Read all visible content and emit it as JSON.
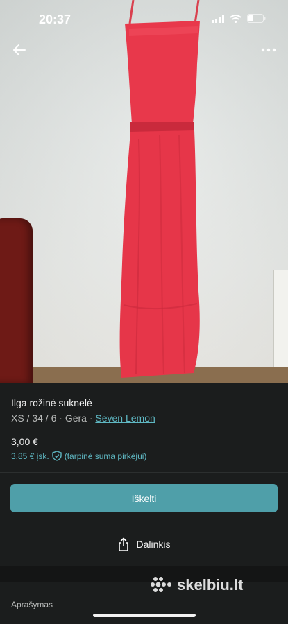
{
  "status_bar": {
    "time": "20:37"
  },
  "listing": {
    "title": "Ilga rožinė suknelė",
    "size_condition": "XS / 34 / 6 · Gera · ",
    "brand": "Seven Lemon",
    "price": "3,00 €",
    "fee_text": "3.85 € įsk.",
    "fee_note": "(tarpinė suma pirkėjui)"
  },
  "actions": {
    "buy_label": "Iškelti",
    "share_label": "Dalinkis"
  },
  "section": {
    "description_label": "Aprašymas"
  },
  "watermark": {
    "text": "skelbiu.lt"
  },
  "colors": {
    "accent": "#4f9fa9",
    "link": "#5fb8c3",
    "background": "#1b1d1d",
    "dress": "#e8384b"
  },
  "icons": [
    "arrow-left-icon",
    "more-icon",
    "share-icon",
    "shield-check-icon",
    "signal-icon",
    "wifi-icon",
    "battery-icon"
  ]
}
